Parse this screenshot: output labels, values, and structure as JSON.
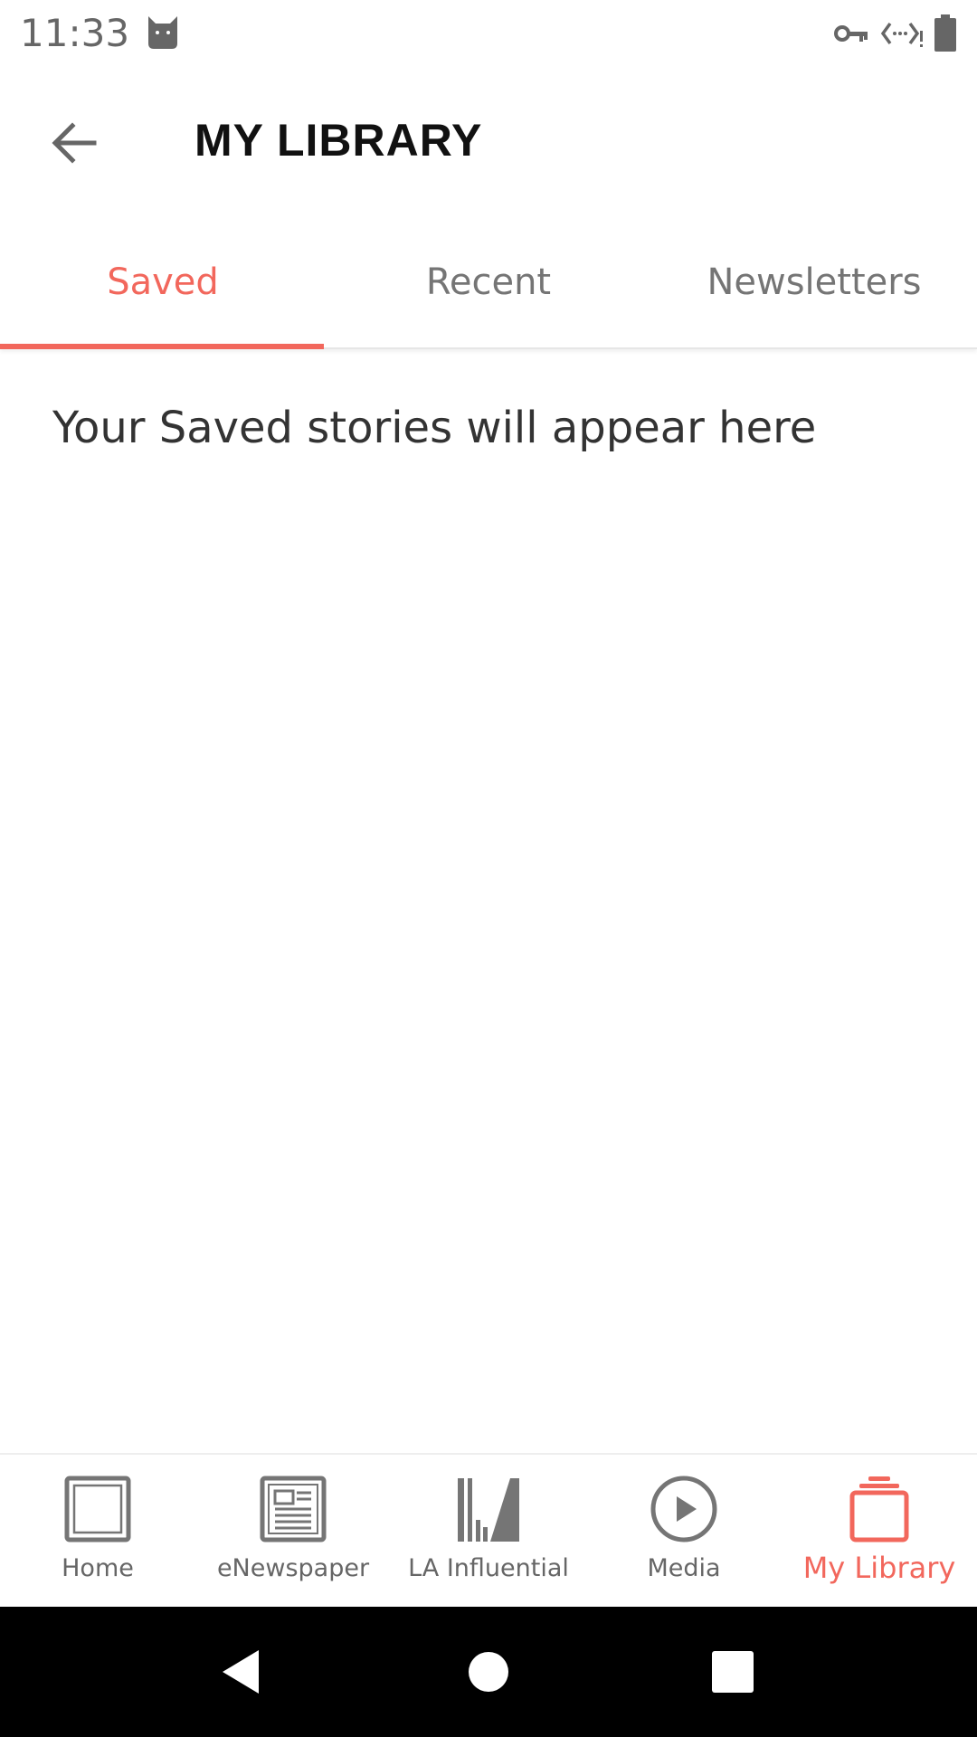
{
  "status_bar": {
    "time": "11:33",
    "icons": [
      "cat-icon",
      "vpn-key-icon",
      "data-saver-icon",
      "battery-icon"
    ]
  },
  "header": {
    "title": "MY LIBRARY",
    "back_icon": "arrow-back-icon"
  },
  "tabs": [
    {
      "label": "Saved",
      "active": true
    },
    {
      "label": "Recent",
      "active": false
    },
    {
      "label": "Newsletters",
      "active": false
    }
  ],
  "main": {
    "empty_message": "Your Saved stories will appear here"
  },
  "bottom_nav": [
    {
      "label": "Home",
      "icon": "home-icon",
      "active": false
    },
    {
      "label": "eNewspaper",
      "icon": "newspaper-icon",
      "active": false
    },
    {
      "label": "LA Influential",
      "icon": "influential-icon",
      "active": false
    },
    {
      "label": "Media",
      "icon": "play-icon",
      "active": false
    },
    {
      "label": "My Library",
      "icon": "library-icon",
      "active": true
    }
  ],
  "colors": {
    "accent": "#f2675c",
    "icon_gray": "#757575",
    "text_dark": "#111111"
  }
}
